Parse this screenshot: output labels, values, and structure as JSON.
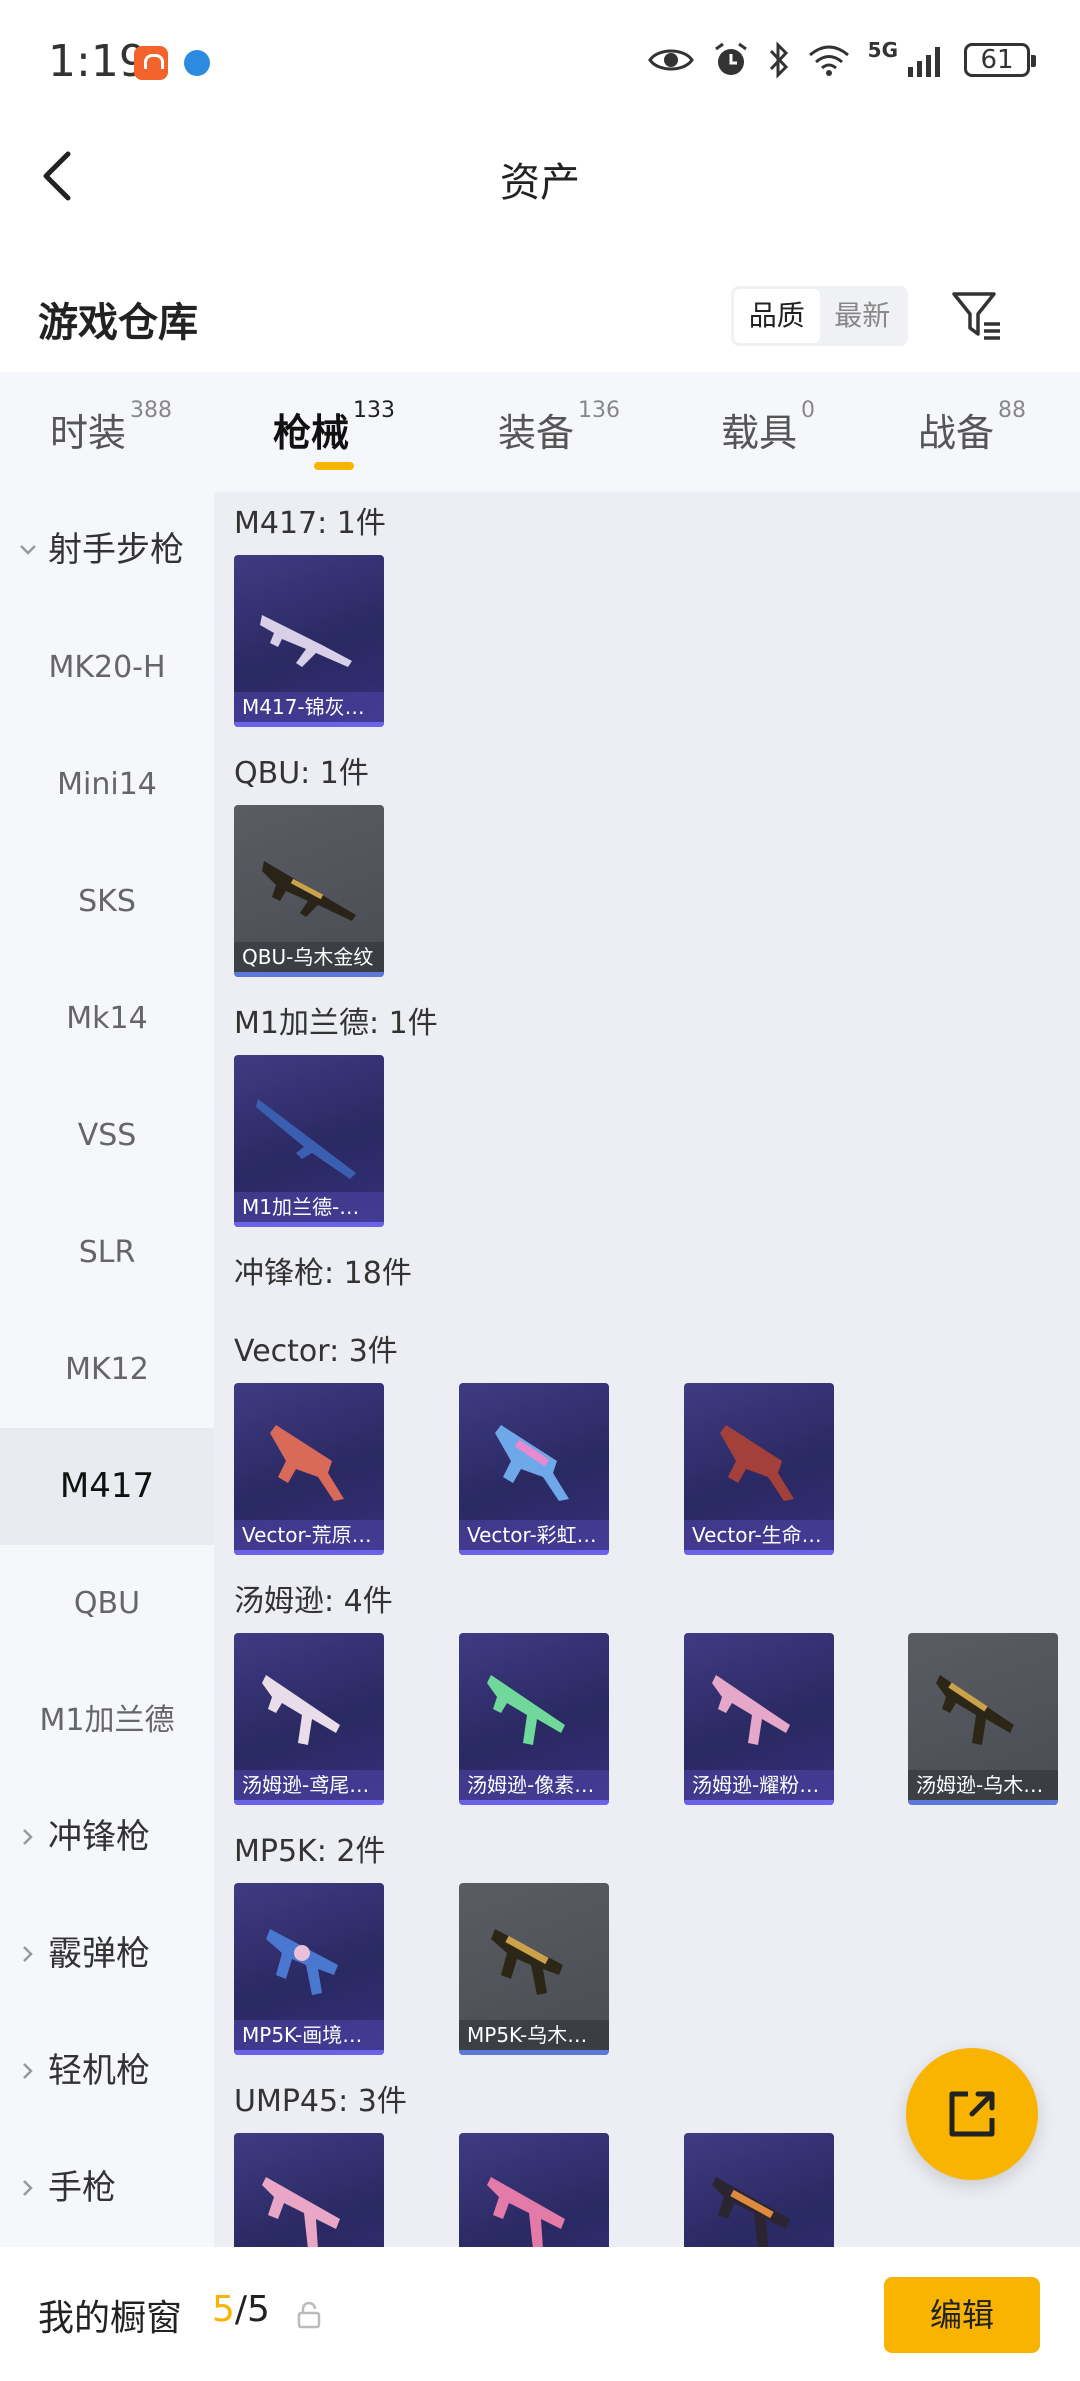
{
  "status_bar": {
    "time": "1:19",
    "network": "5G",
    "battery": "61"
  },
  "header": {
    "title": "资产",
    "back_icon": "chevron-left-icon"
  },
  "warehouse": {
    "title": "游戏仓库",
    "sort_options": [
      "品质",
      "最新"
    ],
    "sort_selected": "品质",
    "filter_icon": "filter-icon"
  },
  "tabs": [
    {
      "label": "时装",
      "count": "388"
    },
    {
      "label": "枪械",
      "count": "133",
      "active": true
    },
    {
      "label": "装备",
      "count": "136"
    },
    {
      "label": "载具",
      "count": "0"
    },
    {
      "label": "战备",
      "count": "88"
    }
  ],
  "sidebar": {
    "items": [
      {
        "label": "射手步枪",
        "type": "group",
        "expanded": true
      },
      {
        "label": "MK20-H"
      },
      {
        "label": "Mini14"
      },
      {
        "label": "SKS"
      },
      {
        "label": "Mk14"
      },
      {
        "label": "VSS"
      },
      {
        "label": "SLR"
      },
      {
        "label": "MK12"
      },
      {
        "label": "M417",
        "active": true
      },
      {
        "label": "QBU"
      },
      {
        "label": "M1加兰德"
      },
      {
        "label": "冲锋枪",
        "type": "group"
      },
      {
        "label": "霰弹枪",
        "type": "group"
      },
      {
        "label": "轻机枪",
        "type": "group"
      },
      {
        "label": "手枪",
        "type": "group"
      }
    ]
  },
  "sections": [
    {
      "label": "M417: 1件",
      "cards": [
        {
          "name": "M417-锦灰…",
          "style": "purple"
        }
      ]
    },
    {
      "label": "QBU: 1件",
      "cards": [
        {
          "name": "QBU-乌木金纹",
          "style": "gray"
        }
      ]
    },
    {
      "label": "M1加兰德: 1件",
      "cards": [
        {
          "name": "M1加兰德-…",
          "style": "purple"
        }
      ]
    },
    {
      "label": "冲锋枪: 18件",
      "cards": []
    },
    {
      "label": "Vector: 3件",
      "cards": [
        {
          "name": "Vector-荒原…",
          "style": "purple"
        },
        {
          "name": "Vector-彩虹…",
          "style": "purple"
        },
        {
          "name": "Vector-生命…",
          "style": "purple"
        }
      ]
    },
    {
      "label": "汤姆逊: 4件",
      "cards": [
        {
          "name": "汤姆逊-鸢尾…",
          "style": "purple"
        },
        {
          "name": "汤姆逊-像素…",
          "style": "purple"
        },
        {
          "name": "汤姆逊-耀粉…",
          "style": "purple"
        },
        {
          "name": "汤姆逊-乌木…",
          "style": "gray"
        }
      ]
    },
    {
      "label": "MP5K: 2件",
      "cards": [
        {
          "name": "MP5K-画境…",
          "style": "purple"
        },
        {
          "name": "MP5K-乌木…",
          "style": "gray"
        }
      ]
    },
    {
      "label": "UMP45: 3件",
      "cards": [
        {
          "name": "",
          "style": "purple"
        },
        {
          "name": "",
          "style": "purple"
        },
        {
          "name": "",
          "style": "purple"
        }
      ]
    }
  ],
  "fab": {
    "icon": "share-icon"
  },
  "bottom_bar": {
    "label": "我的橱窗",
    "count_current": "5",
    "count_total": "/5",
    "edit_label": "编辑"
  },
  "colors": {
    "accent": "#f8b400",
    "card_purple": "#2f2d6e",
    "card_gray": "#505259"
  }
}
